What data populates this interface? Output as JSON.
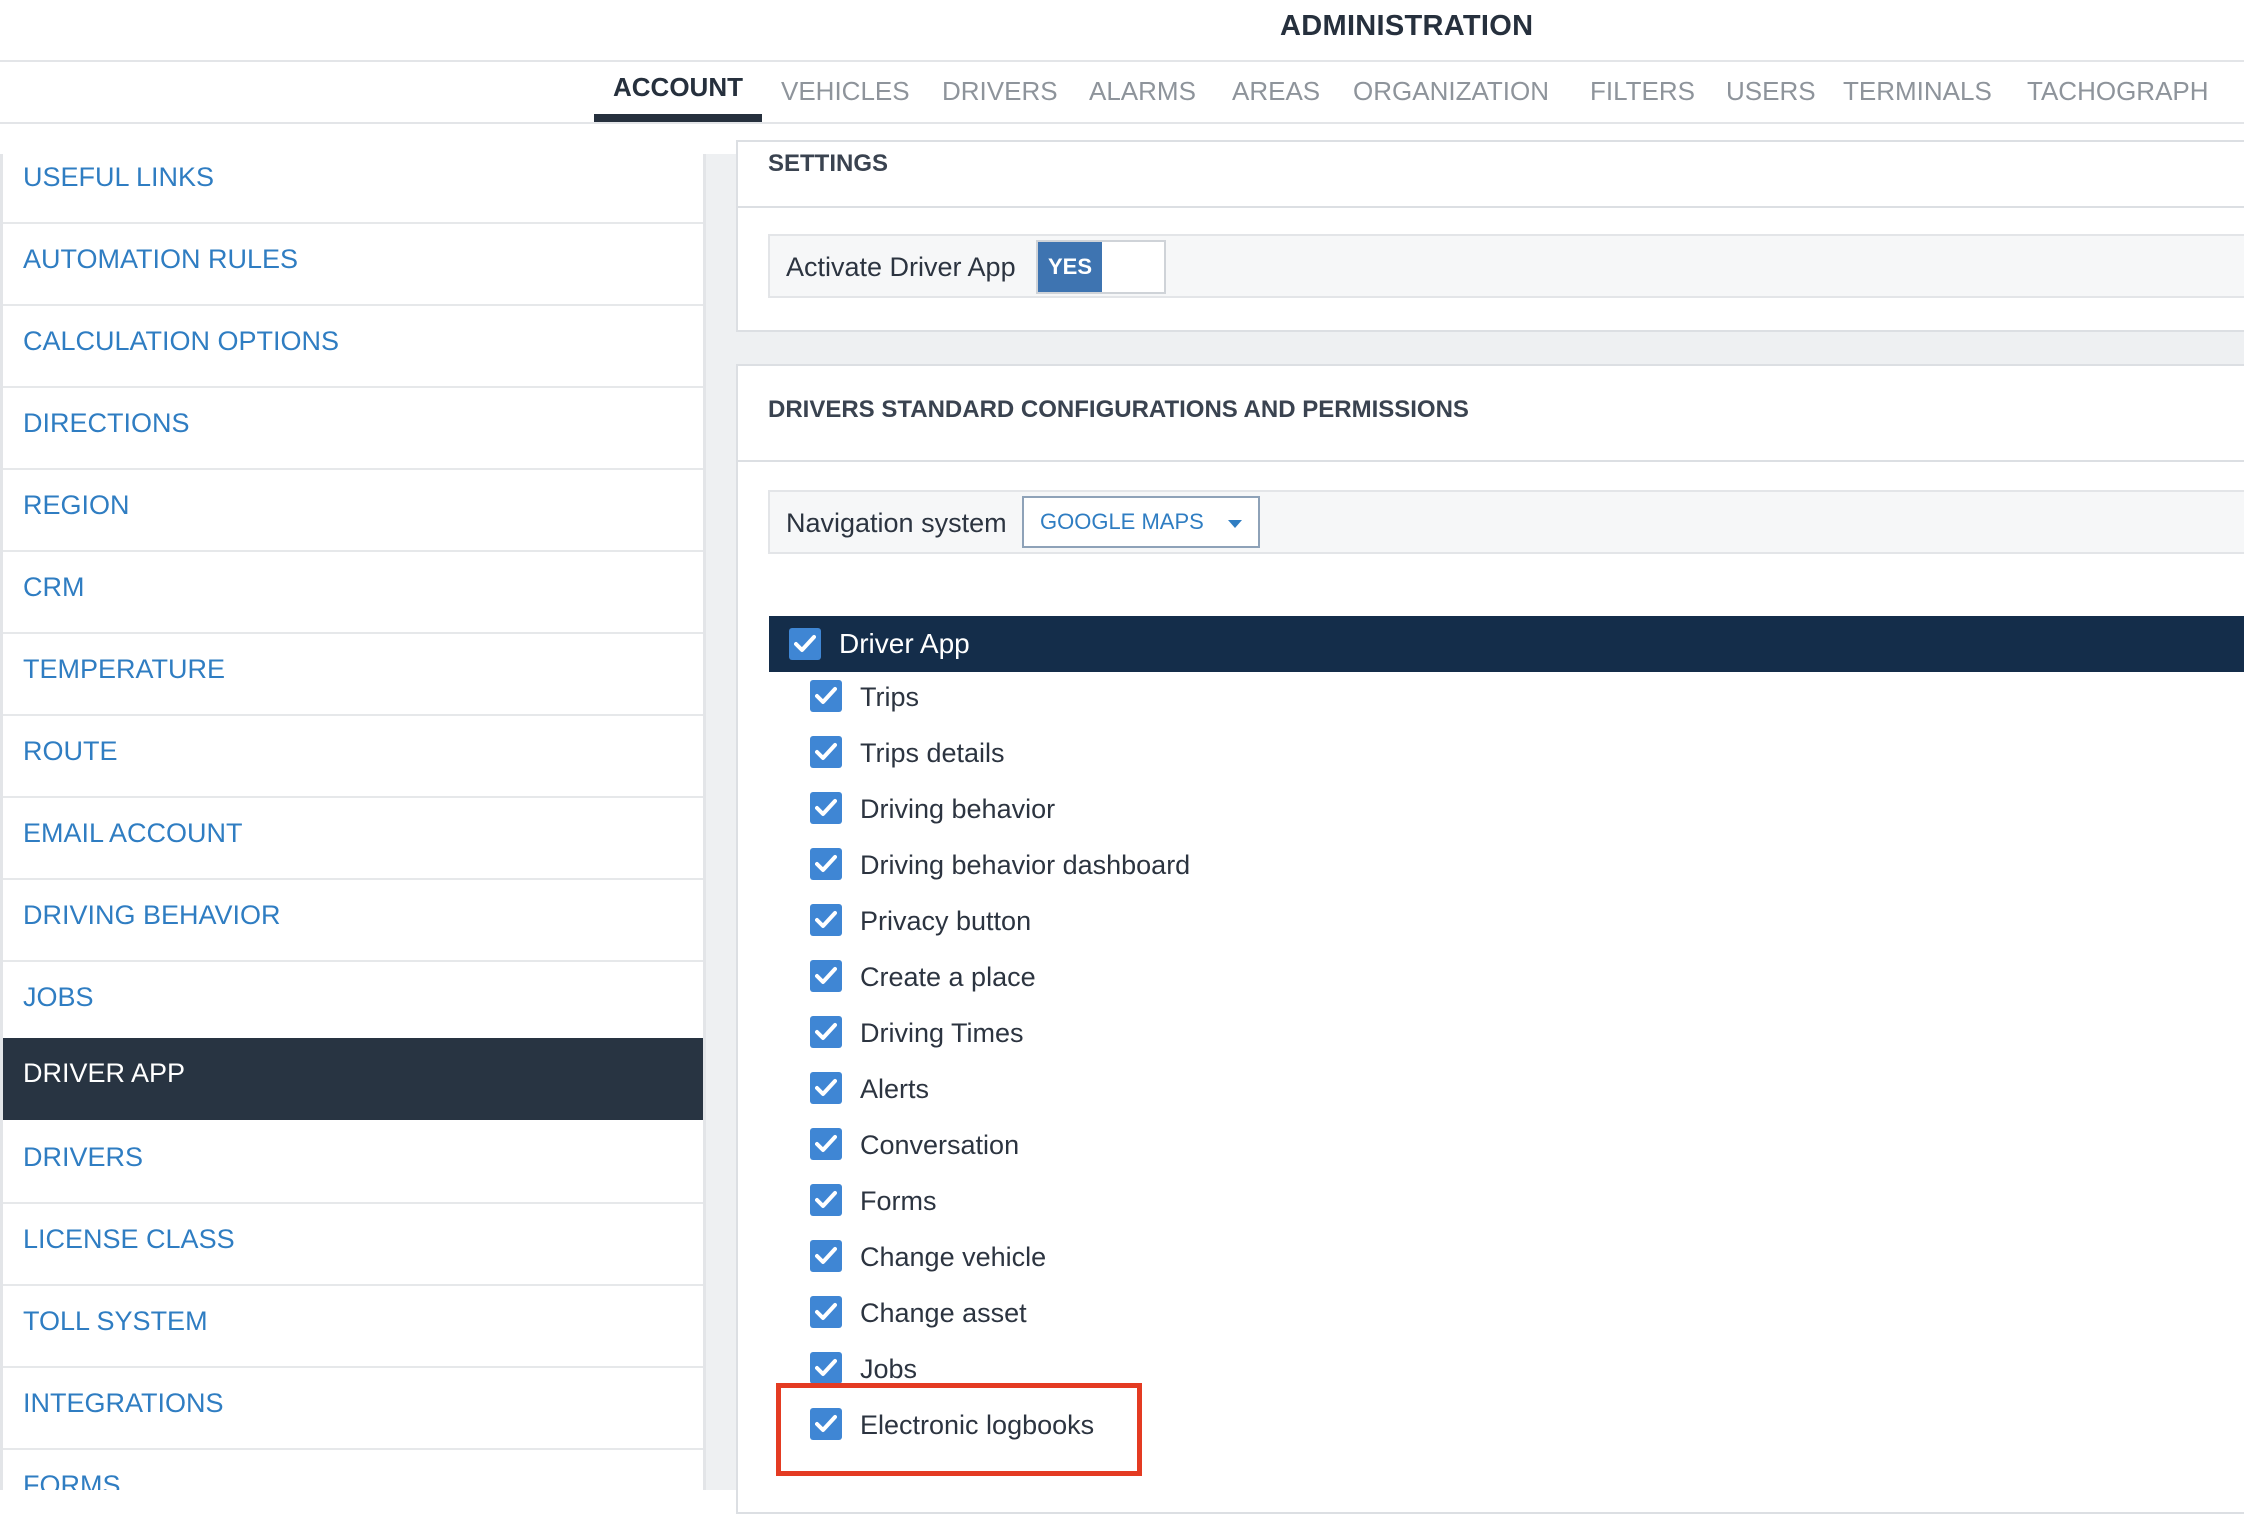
{
  "header": {
    "title": "ADMINISTRATION"
  },
  "tabs": [
    {
      "label": "ACCOUNT",
      "active": true
    },
    {
      "label": "VEHICLES"
    },
    {
      "label": "DRIVERS"
    },
    {
      "label": "ALARMS"
    },
    {
      "label": "AREAS"
    },
    {
      "label": "ORGANIZATION"
    },
    {
      "label": "FILTERS"
    },
    {
      "label": "USERS"
    },
    {
      "label": "TERMINALS"
    },
    {
      "label": "TACHOGRAPH"
    }
  ],
  "sidebar": {
    "items": [
      {
        "label": "USEFUL LINKS"
      },
      {
        "label": "AUTOMATION RULES"
      },
      {
        "label": "CALCULATION OPTIONS"
      },
      {
        "label": "DIRECTIONS"
      },
      {
        "label": "REGION"
      },
      {
        "label": "CRM"
      },
      {
        "label": "TEMPERATURE"
      },
      {
        "label": "ROUTE"
      },
      {
        "label": "EMAIL ACCOUNT"
      },
      {
        "label": "DRIVING BEHAVIOR"
      },
      {
        "label": "JOBS"
      },
      {
        "label": "DRIVER APP",
        "active": true
      },
      {
        "label": "DRIVERS"
      },
      {
        "label": "LICENSE CLASS"
      },
      {
        "label": "TOLL SYSTEM"
      },
      {
        "label": "INTEGRATIONS"
      },
      {
        "label": "FORMS"
      }
    ]
  },
  "settings": {
    "title": "SETTINGS",
    "activate_label": "Activate Driver App",
    "toggle_value": "YES"
  },
  "drivers_config": {
    "title": "DRIVERS STANDARD CONFIGURATIONS AND PERMISSIONS",
    "navigation_label": "Navigation system",
    "navigation_value": "GOOGLE MAPS",
    "group_label": "Driver App",
    "permissions": [
      {
        "label": "Trips",
        "checked": true
      },
      {
        "label": "Trips details",
        "checked": true
      },
      {
        "label": "Driving behavior",
        "checked": true
      },
      {
        "label": "Driving behavior dashboard",
        "checked": true
      },
      {
        "label": "Privacy button",
        "checked": true
      },
      {
        "label": "Create a place",
        "checked": true
      },
      {
        "label": "Driving Times",
        "checked": true
      },
      {
        "label": "Alerts",
        "checked": true
      },
      {
        "label": "Conversation",
        "checked": true
      },
      {
        "label": "Forms",
        "checked": true
      },
      {
        "label": "Change vehicle",
        "checked": true
      },
      {
        "label": "Change asset",
        "checked": true
      },
      {
        "label": "Jobs",
        "checked": true
      },
      {
        "label": "Electronic logbooks",
        "checked": true
      }
    ]
  },
  "colors": {
    "accent_link": "#2f7dc2",
    "active_sidebar": "#283442",
    "group_bar": "#142d4a",
    "checkbox": "#3f86d4",
    "highlight": "#e43b22"
  }
}
